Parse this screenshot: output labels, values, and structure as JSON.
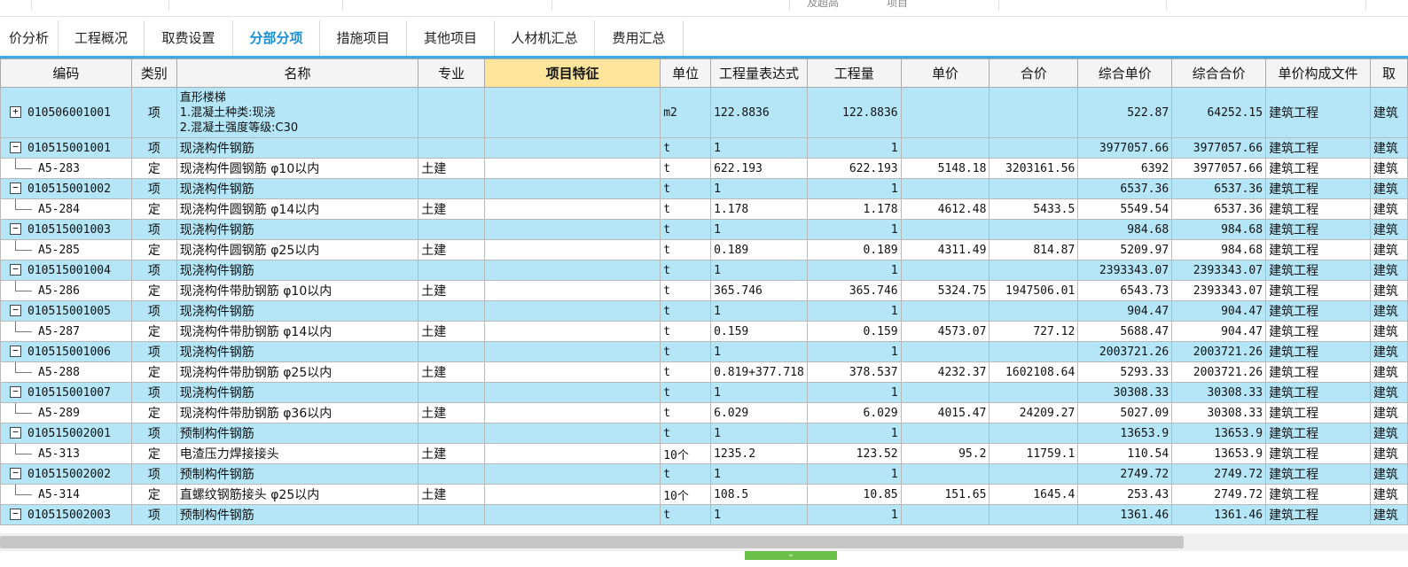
{
  "top_strip": {
    "labels": [
      "及超高",
      "项目"
    ]
  },
  "tabs": [
    {
      "label": "价分析",
      "active": false
    },
    {
      "label": "工程概况",
      "active": false
    },
    {
      "label": "取费设置",
      "active": false
    },
    {
      "label": "分部分项",
      "active": true
    },
    {
      "label": "措施项目",
      "active": false
    },
    {
      "label": "其他项目",
      "active": false
    },
    {
      "label": "人材机汇总",
      "active": false
    },
    {
      "label": "费用汇总",
      "active": false
    }
  ],
  "columns": [
    "编码",
    "类别",
    "名称",
    "专业",
    "项目特征",
    "单位",
    "工程量表达式",
    "工程量",
    "单价",
    "合价",
    "综合单价",
    "综合合价",
    "单价构成文件",
    "取"
  ],
  "rows": [
    {
      "kind": "xiang",
      "expander": "+",
      "code": "010506001001",
      "type": "项",
      "name": "直形楼梯\n1.混凝土种类:现浇\n2.混凝土强度等级:C30",
      "spec": "",
      "feature": "",
      "unit": "m2",
      "expr": "122.8836",
      "qty": "122.8836",
      "price": "",
      "total": "",
      "cprice": "522.87",
      "ctotal": "64252.15",
      "file": "建筑工程",
      "extra": "建筑"
    },
    {
      "kind": "xiang",
      "expander": "−",
      "code": "010515001001",
      "type": "项",
      "name": "现浇构件钢筋",
      "spec": "",
      "feature": "",
      "unit": "t",
      "expr": "1",
      "qty": "1",
      "price": "",
      "total": "",
      "cprice": "3977057.66",
      "ctotal": "3977057.66",
      "file": "建筑工程",
      "extra": "建筑"
    },
    {
      "kind": "ding",
      "code": "A5-283",
      "type": "定",
      "name": "现浇构件圆钢筋 φ10以内",
      "spec": "土建",
      "feature": "",
      "unit": "t",
      "expr": "622.193",
      "qty": "622.193",
      "price": "5148.18",
      "total": "3203161.56",
      "cprice": "6392",
      "ctotal": "3977057.66",
      "file": "建筑工程",
      "extra": "建筑"
    },
    {
      "kind": "xiang",
      "expander": "−",
      "code": "010515001002",
      "type": "项",
      "name": "现浇构件钢筋",
      "spec": "",
      "feature": "",
      "unit": "t",
      "expr": "1",
      "qty": "1",
      "price": "",
      "total": "",
      "cprice": "6537.36",
      "ctotal": "6537.36",
      "file": "建筑工程",
      "extra": "建筑"
    },
    {
      "kind": "ding",
      "code": "A5-284",
      "type": "定",
      "name": "现浇构件圆钢筋 φ14以内",
      "spec": "土建",
      "feature": "",
      "unit": "t",
      "expr": "1.178",
      "qty": "1.178",
      "price": "4612.48",
      "total": "5433.5",
      "cprice": "5549.54",
      "ctotal": "6537.36",
      "file": "建筑工程",
      "extra": "建筑"
    },
    {
      "kind": "xiang",
      "expander": "−",
      "code": "010515001003",
      "type": "项",
      "name": "现浇构件钢筋",
      "spec": "",
      "feature": "",
      "unit": "t",
      "expr": "1",
      "qty": "1",
      "price": "",
      "total": "",
      "cprice": "984.68",
      "ctotal": "984.68",
      "file": "建筑工程",
      "extra": "建筑"
    },
    {
      "kind": "ding",
      "code": "A5-285",
      "type": "定",
      "name": "现浇构件圆钢筋 φ25以内",
      "spec": "土建",
      "feature": "",
      "unit": "t",
      "expr": "0.189",
      "qty": "0.189",
      "price": "4311.49",
      "total": "814.87",
      "cprice": "5209.97",
      "ctotal": "984.68",
      "file": "建筑工程",
      "extra": "建筑"
    },
    {
      "kind": "xiang",
      "expander": "−",
      "code": "010515001004",
      "type": "项",
      "name": "现浇构件钢筋",
      "spec": "",
      "feature": "",
      "unit": "t",
      "expr": "1",
      "qty": "1",
      "price": "",
      "total": "",
      "cprice": "2393343.07",
      "ctotal": "2393343.07",
      "file": "建筑工程",
      "extra": "建筑"
    },
    {
      "kind": "ding",
      "code": "A5-286",
      "type": "定",
      "name": "现浇构件带肋钢筋 φ10以内",
      "spec": "土建",
      "feature": "",
      "unit": "t",
      "expr": "365.746",
      "qty": "365.746",
      "price": "5324.75",
      "total": "1947506.01",
      "cprice": "6543.73",
      "ctotal": "2393343.07",
      "file": "建筑工程",
      "extra": "建筑"
    },
    {
      "kind": "xiang",
      "expander": "−",
      "code": "010515001005",
      "type": "项",
      "name": "现浇构件钢筋",
      "spec": "",
      "feature": "",
      "unit": "t",
      "expr": "1",
      "qty": "1",
      "price": "",
      "total": "",
      "cprice": "904.47",
      "ctotal": "904.47",
      "file": "建筑工程",
      "extra": "建筑"
    },
    {
      "kind": "ding",
      "code": "A5-287",
      "type": "定",
      "name": "现浇构件带肋钢筋 φ14以内",
      "spec": "土建",
      "feature": "",
      "unit": "t",
      "expr": "0.159",
      "qty": "0.159",
      "price": "4573.07",
      "total": "727.12",
      "cprice": "5688.47",
      "ctotal": "904.47",
      "file": "建筑工程",
      "extra": "建筑"
    },
    {
      "kind": "xiang",
      "expander": "−",
      "code": "010515001006",
      "type": "项",
      "name": "现浇构件钢筋",
      "spec": "",
      "feature": "",
      "unit": "t",
      "expr": "1",
      "qty": "1",
      "price": "",
      "total": "",
      "cprice": "2003721.26",
      "ctotal": "2003721.26",
      "file": "建筑工程",
      "extra": "建筑"
    },
    {
      "kind": "ding",
      "code": "A5-288",
      "type": "定",
      "name": "现浇构件带肋钢筋 φ25以内",
      "spec": "土建",
      "feature": "",
      "unit": "t",
      "expr": "0.819+377.718",
      "qty": "378.537",
      "price": "4232.37",
      "total": "1602108.64",
      "cprice": "5293.33",
      "ctotal": "2003721.26",
      "file": "建筑工程",
      "extra": "建筑"
    },
    {
      "kind": "xiang",
      "expander": "−",
      "code": "010515001007",
      "type": "项",
      "name": "现浇构件钢筋",
      "spec": "",
      "feature": "",
      "unit": "t",
      "expr": "1",
      "qty": "1",
      "price": "",
      "total": "",
      "cprice": "30308.33",
      "ctotal": "30308.33",
      "file": "建筑工程",
      "extra": "建筑"
    },
    {
      "kind": "ding",
      "code": "A5-289",
      "type": "定",
      "name": "现浇构件带肋钢筋 φ36以内",
      "spec": "土建",
      "feature": "",
      "unit": "t",
      "expr": "6.029",
      "qty": "6.029",
      "price": "4015.47",
      "total": "24209.27",
      "cprice": "5027.09",
      "ctotal": "30308.33",
      "file": "建筑工程",
      "extra": "建筑"
    },
    {
      "kind": "xiang",
      "expander": "−",
      "code": "010515002001",
      "type": "项",
      "name": "预制构件钢筋",
      "spec": "",
      "feature": "",
      "unit": "t",
      "expr": "1",
      "qty": "1",
      "price": "",
      "total": "",
      "cprice": "13653.9",
      "ctotal": "13653.9",
      "file": "建筑工程",
      "extra": "建筑"
    },
    {
      "kind": "ding",
      "code": "A5-313",
      "type": "定",
      "name": "电渣压力焊接接头",
      "spec": "土建",
      "feature": "",
      "unit": "10个",
      "expr": "1235.2",
      "qty": "123.52",
      "price": "95.2",
      "total": "11759.1",
      "cprice": "110.54",
      "ctotal": "13653.9",
      "file": "建筑工程",
      "extra": "建筑"
    },
    {
      "kind": "xiang",
      "expander": "−",
      "code": "010515002002",
      "type": "项",
      "name": "预制构件钢筋",
      "spec": "",
      "feature": "",
      "unit": "t",
      "expr": "1",
      "qty": "1",
      "price": "",
      "total": "",
      "cprice": "2749.72",
      "ctotal": "2749.72",
      "file": "建筑工程",
      "extra": "建筑"
    },
    {
      "kind": "ding",
      "code": "A5-314",
      "type": "定",
      "name": "直螺纹钢筋接头 φ25以内",
      "spec": "土建",
      "feature": "",
      "unit": "10个",
      "expr": "108.5",
      "qty": "10.85",
      "price": "151.65",
      "total": "1645.4",
      "cprice": "253.43",
      "ctotal": "2749.72",
      "file": "建筑工程",
      "extra": "建筑"
    },
    {
      "kind": "xiang",
      "expander": "−",
      "code": "010515002003",
      "type": "项",
      "name": "预制构件钢筋",
      "spec": "",
      "feature": "",
      "unit": "t",
      "expr": "1",
      "qty": "1",
      "price": "",
      "total": "",
      "cprice": "1361.46",
      "ctotal": "1361.46",
      "file": "建筑工程",
      "extra": "建筑"
    }
  ],
  "colors": {
    "item_row": "#b4e6f7",
    "quota_row": "#ffffff",
    "feature_header": "#fce59b",
    "tab_active": "#1a8fd6",
    "tab_underline": "#3fa9e6"
  },
  "icons": {
    "expand": "plus-box-icon",
    "collapse": "minus-box-icon",
    "handle": "chevron-down-icon"
  }
}
